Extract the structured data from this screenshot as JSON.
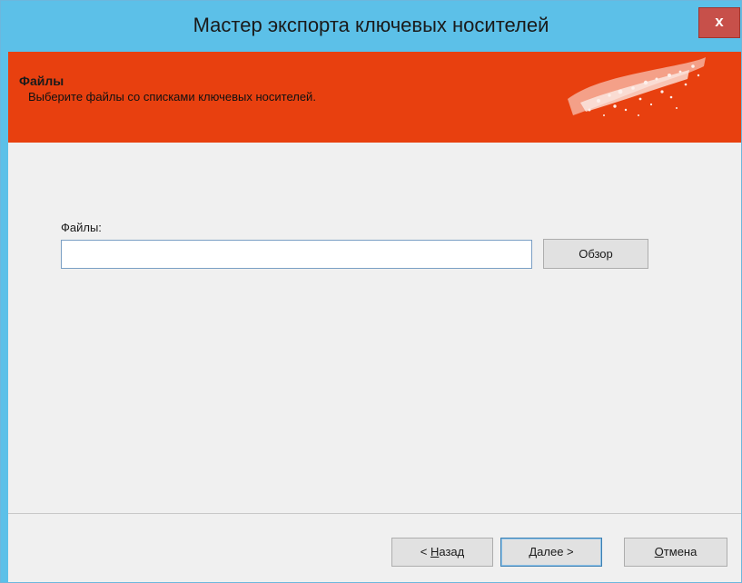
{
  "window": {
    "title": "Мастер экспорта ключевых носителей",
    "close_label": "x"
  },
  "header": {
    "title": "Файлы",
    "subtitle": "Выберите файлы со списками ключевых носителей."
  },
  "form": {
    "files_label": "Файлы:",
    "files_value": "",
    "browse_label": "Обзор"
  },
  "footer": {
    "back": {
      "mnemonic": "Н",
      "rest": "азад",
      "prefix": "< "
    },
    "next": {
      "mnemonic": "Д",
      "rest": "алее >"
    },
    "cancel": {
      "mnemonic": "О",
      "rest": "тмена"
    }
  }
}
